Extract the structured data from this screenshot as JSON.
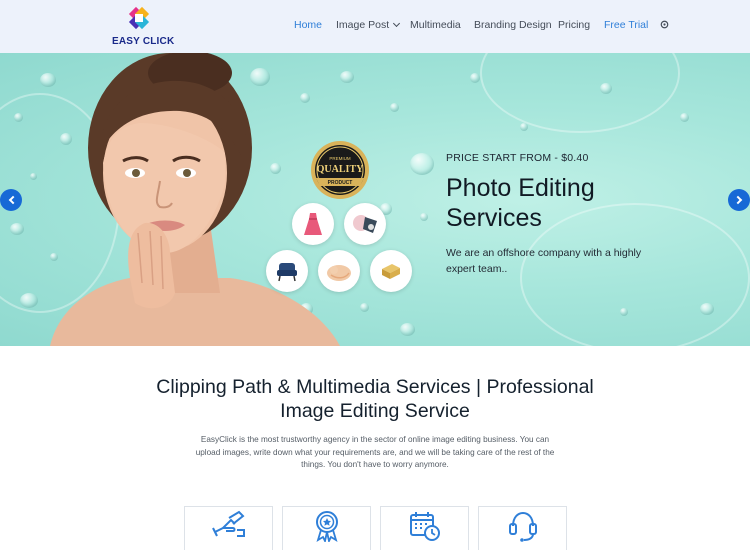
{
  "brand": {
    "name": "EASY CLICK"
  },
  "nav": {
    "items": [
      {
        "label": "Home"
      },
      {
        "label": "Image Post"
      },
      {
        "label": "Multimedia"
      },
      {
        "label": "Branding Design"
      },
      {
        "label": "Pricing"
      },
      {
        "label": "Free Trial"
      }
    ]
  },
  "hero": {
    "price_label": "PRICE START FROM - $0.40",
    "title_line1": "Photo Editing",
    "title_line2": "Services",
    "description": "We are an offshore company with a highly expert team..",
    "badge": {
      "top": "PREMIUM",
      "main": "QUALITY",
      "bottom": "PRODUCT"
    }
  },
  "content": {
    "title_line1": "Clipping Path & Multimedia Services | Professional",
    "title_line2": "Image Editing Service",
    "description": "EasyClick is the most trustworthy agency in the sector of online image editing business. You can upload images, write down what your requirements are, and we will be taking care of the rest of the things. You don't have to worry anymore."
  },
  "features": [
    {
      "icon": "hand-pen-icon"
    },
    {
      "icon": "award-icon"
    },
    {
      "icon": "calendar-clock-icon"
    },
    {
      "icon": "headset-icon"
    }
  ],
  "colors": {
    "accent": "#2f7fd8",
    "arrow": "#1769d6",
    "header_bg": "#edf2fb",
    "hero_bg": "#a6e6db"
  }
}
